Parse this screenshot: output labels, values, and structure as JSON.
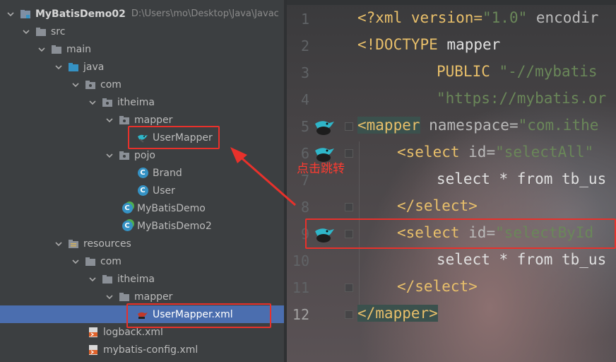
{
  "project": {
    "root_name": "MyBatisDemo02",
    "root_path": "D:\\Users\\mo\\Desktop\\Java\\Javac",
    "src": "src",
    "main": "main",
    "java": "java",
    "com": "com",
    "itheima": "itheima",
    "mapper": "mapper",
    "user_mapper": "UserMapper",
    "pojo": "pojo",
    "brand": "Brand",
    "user": "User",
    "mybatis_demo": "MyBatisDemo",
    "mybatis_demo2": "MyBatisDemo2",
    "resources": "resources",
    "res_com": "com",
    "res_itheima": "itheima",
    "res_mapper": "mapper",
    "user_mapper_xml": "UserMapper.xml",
    "logback": "logback.xml",
    "mybatis_config": "mybatis-config.xml"
  },
  "annotation": {
    "note": "点击跳转",
    "color": "#e8312b"
  },
  "editor": {
    "line_numbers": [
      "1",
      "2",
      "3",
      "4",
      "5",
      "6",
      "7",
      "8",
      "9",
      "10",
      "11",
      "12"
    ],
    "lines": {
      "l1": {
        "a": "<?xml version=",
        "b": "\"1.0\"",
        "c": " encodir"
      },
      "l2": {
        "a": "<!DOCTYPE",
        "b": " mapper"
      },
      "l3": {
        "a": "PUBLIC",
        "b": " \"-//mybatis"
      },
      "l4": {
        "a": "\"https://mybatis.or"
      },
      "l5": {
        "a": "<mapper",
        "b": " namespace=",
        "c": "\"com.ithe"
      },
      "l6": {
        "a": "<select",
        "b": " id=",
        "c": "\"selectAll\""
      },
      "l7": {
        "a": "select * from tb_us"
      },
      "l8": {
        "a": "</select>"
      },
      "l9": {
        "a": "<select",
        "b": " id=",
        "c": "\"selectById"
      },
      "l10": {
        "a": "select * from tb_us"
      },
      "l11": {
        "a": "</select>"
      },
      "l12": {
        "a": "</mapper>"
      }
    }
  },
  "colors": {
    "tree_bg": "#3c3f41",
    "selected": "#4b6eaf",
    "xml_tag": "#e8bf6a",
    "xml_string": "#6a8759",
    "keyword": "#cc7832"
  },
  "icons": {
    "folder": "folder-icon",
    "source_folder": "source-folder-icon",
    "package": "package-icon",
    "class": "class-icon",
    "main_class": "runnable-class-icon",
    "mybatis_bird": "mybatis-bird-icon",
    "xml": "xml-file-icon"
  }
}
